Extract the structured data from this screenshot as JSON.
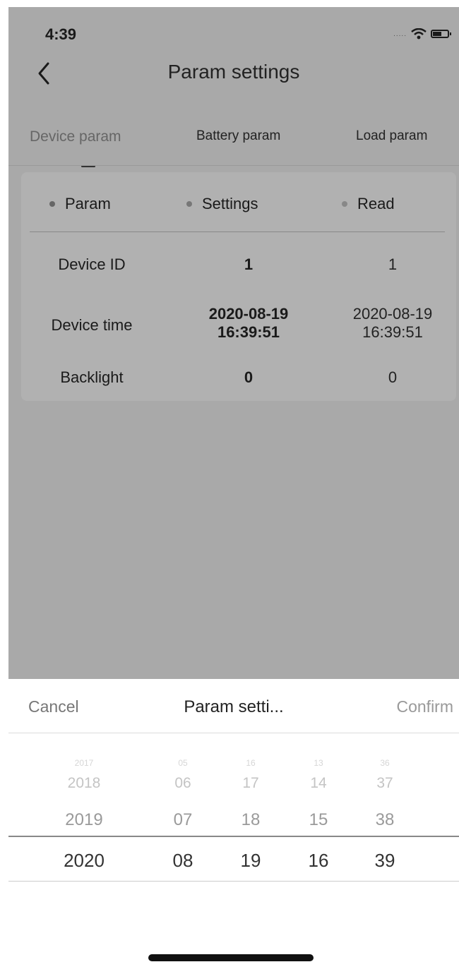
{
  "status_bar": {
    "time": "4:39",
    "signal": "....."
  },
  "nav": {
    "title": "Param settings"
  },
  "tabs": [
    {
      "label": "Device param",
      "active": true
    },
    {
      "label": "Battery param",
      "active": false
    },
    {
      "label": "Load param",
      "active": false
    }
  ],
  "table": {
    "headers": [
      "Param",
      "Settings",
      "Read"
    ],
    "rows": [
      {
        "param": "Device ID",
        "settings": "1",
        "read": "1"
      },
      {
        "param": "Device time",
        "settings": "2020-08-19\n16:39:51",
        "read": "2020-08-19\n16:39:51"
      },
      {
        "param": "Backlight",
        "settings": "0",
        "read": "0"
      }
    ]
  },
  "picker": {
    "cancel_label": "Cancel",
    "title": "Param setti...",
    "confirm_label": "Confirm",
    "columns": [
      {
        "faint": "2017",
        "far": "2018",
        "near": "2019",
        "selected": "2020"
      },
      {
        "faint": "05",
        "far": "06",
        "near": "07",
        "selected": "08"
      },
      {
        "faint": "16",
        "far": "17",
        "near": "18",
        "selected": "19"
      },
      {
        "faint": "13",
        "far": "14",
        "near": "15",
        "selected": "16"
      },
      {
        "faint": "36",
        "far": "37",
        "near": "38",
        "selected": "39"
      }
    ]
  },
  "colors": {
    "overlay": "#a9a9a9",
    "card": "#b1b1b1",
    "sheet": "#ffffff"
  }
}
